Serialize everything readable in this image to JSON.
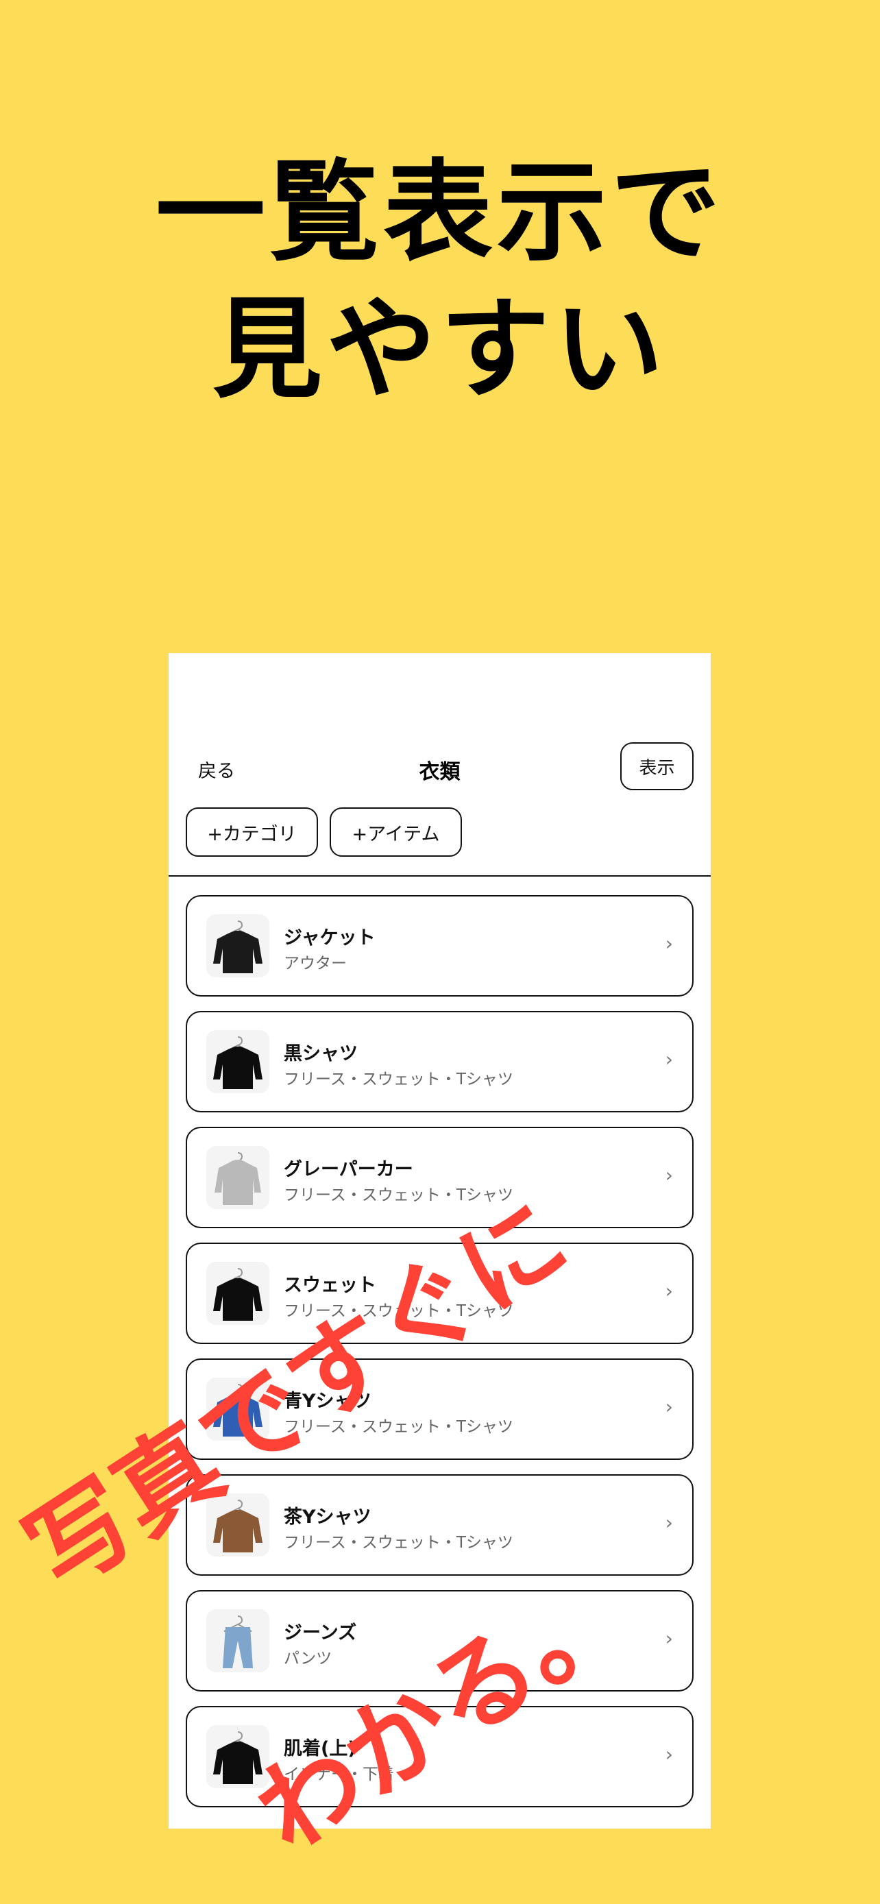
{
  "headline": {
    "line1": "一覧表示で",
    "line2": "見やすい"
  },
  "nav": {
    "back": "戻る",
    "title": "衣類",
    "display_button": "表示"
  },
  "actions": {
    "add_category": "+カテゴリ",
    "add_item": "+アイテム"
  },
  "items": [
    {
      "name": "ジャケット",
      "category": "アウター",
      "icon": "puffer-jacket-icon",
      "color": "#1a1a1a"
    },
    {
      "name": "黒シャツ",
      "category": "フリース・スウェット・Tシャツ",
      "icon": "black-shirt-icon",
      "color": "#0d0d0d"
    },
    {
      "name": "グレーパーカー",
      "category": "フリース・スウェット・Tシャツ",
      "icon": "gray-hoodie-icon",
      "color": "#b9b9b9"
    },
    {
      "name": "スウェット",
      "category": "フリース・スウェット・Tシャツ",
      "icon": "sweatshirt-icon",
      "color": "#0d0d0d"
    },
    {
      "name": "青Yシャツ",
      "category": "フリース・スウェット・Tシャツ",
      "icon": "blue-shirt-icon",
      "color": "#2f5fb4"
    },
    {
      "name": "茶Yシャツ",
      "category": "フリース・スウェット・Tシャツ",
      "icon": "brown-shirt-icon",
      "color": "#8a5a36"
    },
    {
      "name": "ジーンズ",
      "category": "パンツ",
      "icon": "jeans-icon",
      "color": "#7ea6cc"
    },
    {
      "name": "肌着(上)",
      "category": "インナー・下着",
      "icon": "undershirt-icon",
      "color": "#0d0d0d"
    }
  ],
  "chevron": "›",
  "overlay": {
    "line1": "写真ですぐに",
    "line2": "わかる。",
    "color_main": "#FF4236",
    "color_alt": "#FF8A3C"
  },
  "colors": {
    "background": "#FDDC58"
  }
}
